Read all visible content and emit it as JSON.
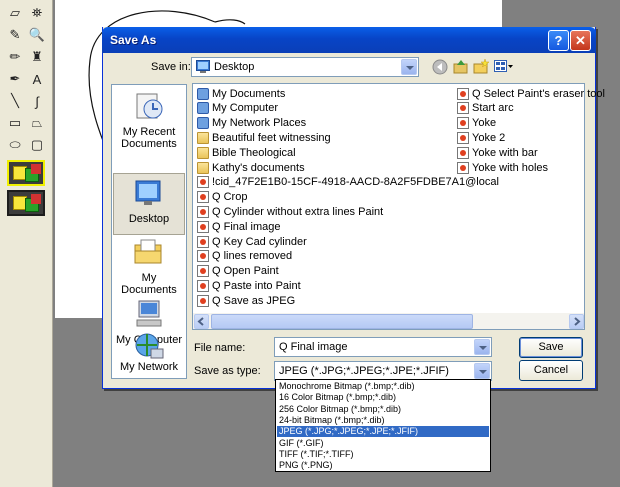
{
  "paint": {
    "tools": [
      {
        "name": "eraser-tool",
        "glyph": "▱"
      },
      {
        "name": "fill-tool",
        "glyph": "⛯"
      },
      {
        "name": "picker-tool",
        "glyph": "✎"
      },
      {
        "name": "magnifier-tool",
        "glyph": "🔍"
      },
      {
        "name": "pencil-tool",
        "glyph": "✏"
      },
      {
        "name": "brush-tool",
        "glyph": "♜"
      },
      {
        "name": "airbrush-tool",
        "glyph": "✒"
      },
      {
        "name": "text-tool",
        "glyph": "A"
      },
      {
        "name": "line-tool",
        "glyph": "╲"
      },
      {
        "name": "curve-tool",
        "glyph": "∫"
      },
      {
        "name": "rectangle-tool",
        "glyph": "▭"
      },
      {
        "name": "polygon-tool",
        "glyph": "⏢"
      },
      {
        "name": "ellipse-tool",
        "glyph": "⬭"
      },
      {
        "name": "rounded-rect-tool",
        "glyph": "▢"
      }
    ]
  },
  "dialog": {
    "title": "Save As",
    "help_label": "?",
    "close_label": "✕",
    "save_in_label": "Save in:",
    "save_in_value": "Desktop",
    "places": [
      "My Recent Documents",
      "Desktop",
      "My Documents",
      "My Computer",
      "My Network"
    ],
    "files_col1": [
      {
        "label": "My Documents",
        "icon": "special"
      },
      {
        "label": "My Computer",
        "icon": "special"
      },
      {
        "label": "My Network Places",
        "icon": "special"
      },
      {
        "label": "Beautiful feet witnessing",
        "icon": "folder"
      },
      {
        "label": "Bible Theological",
        "icon": "folder"
      },
      {
        "label": "Kathy's documents",
        "icon": "folder"
      },
      {
        "label": "!cid_47F2E1B0-15CF-4918-AACD-8A2F5FDBE7A1@local",
        "icon": "paint"
      },
      {
        "label": "Q Crop",
        "icon": "paint"
      },
      {
        "label": "Q Cylinder without extra lines Paint",
        "icon": "paint"
      },
      {
        "label": "Q Final image",
        "icon": "paint"
      },
      {
        "label": "Q Key Cad cylinder",
        "icon": "paint"
      },
      {
        "label": "Q lines removed",
        "icon": "paint"
      },
      {
        "label": "Q Open Paint",
        "icon": "paint"
      },
      {
        "label": "Q Paste into Paint",
        "icon": "paint"
      },
      {
        "label": "Q Save as JPEG",
        "icon": "paint"
      }
    ],
    "files_col2": [
      {
        "label": "Q Select Paint's eraser tool",
        "icon": "paint"
      },
      {
        "label": "Start arc",
        "icon": "paint"
      },
      {
        "label": "Yoke",
        "icon": "paint"
      },
      {
        "label": "Yoke 2",
        "icon": "paint"
      },
      {
        "label": "Yoke with bar",
        "icon": "paint"
      },
      {
        "label": "Yoke with holes",
        "icon": "paint"
      }
    ],
    "file_name_label": "File name:",
    "file_name_value": "Q Final image",
    "save_type_label": "Save as type:",
    "save_type_value": "JPEG (*.JPG;*.JPEG;*.JPE;*.JFIF)",
    "save_button": "Save",
    "cancel_button": "Cancel",
    "type_options": [
      "Monochrome Bitmap (*.bmp;*.dib)",
      "16 Color Bitmap (*.bmp;*.dib)",
      "256 Color Bitmap (*.bmp;*.dib)",
      "24-bit Bitmap (*.bmp;*.dib)",
      "JPEG (*.JPG;*.JPEG;*.JPE;*.JFIF)",
      "GIF (*.GIF)",
      "TIFF (*.TIF;*.TIFF)",
      "PNG (*.PNG)"
    ],
    "selected_type_index": 4
  }
}
